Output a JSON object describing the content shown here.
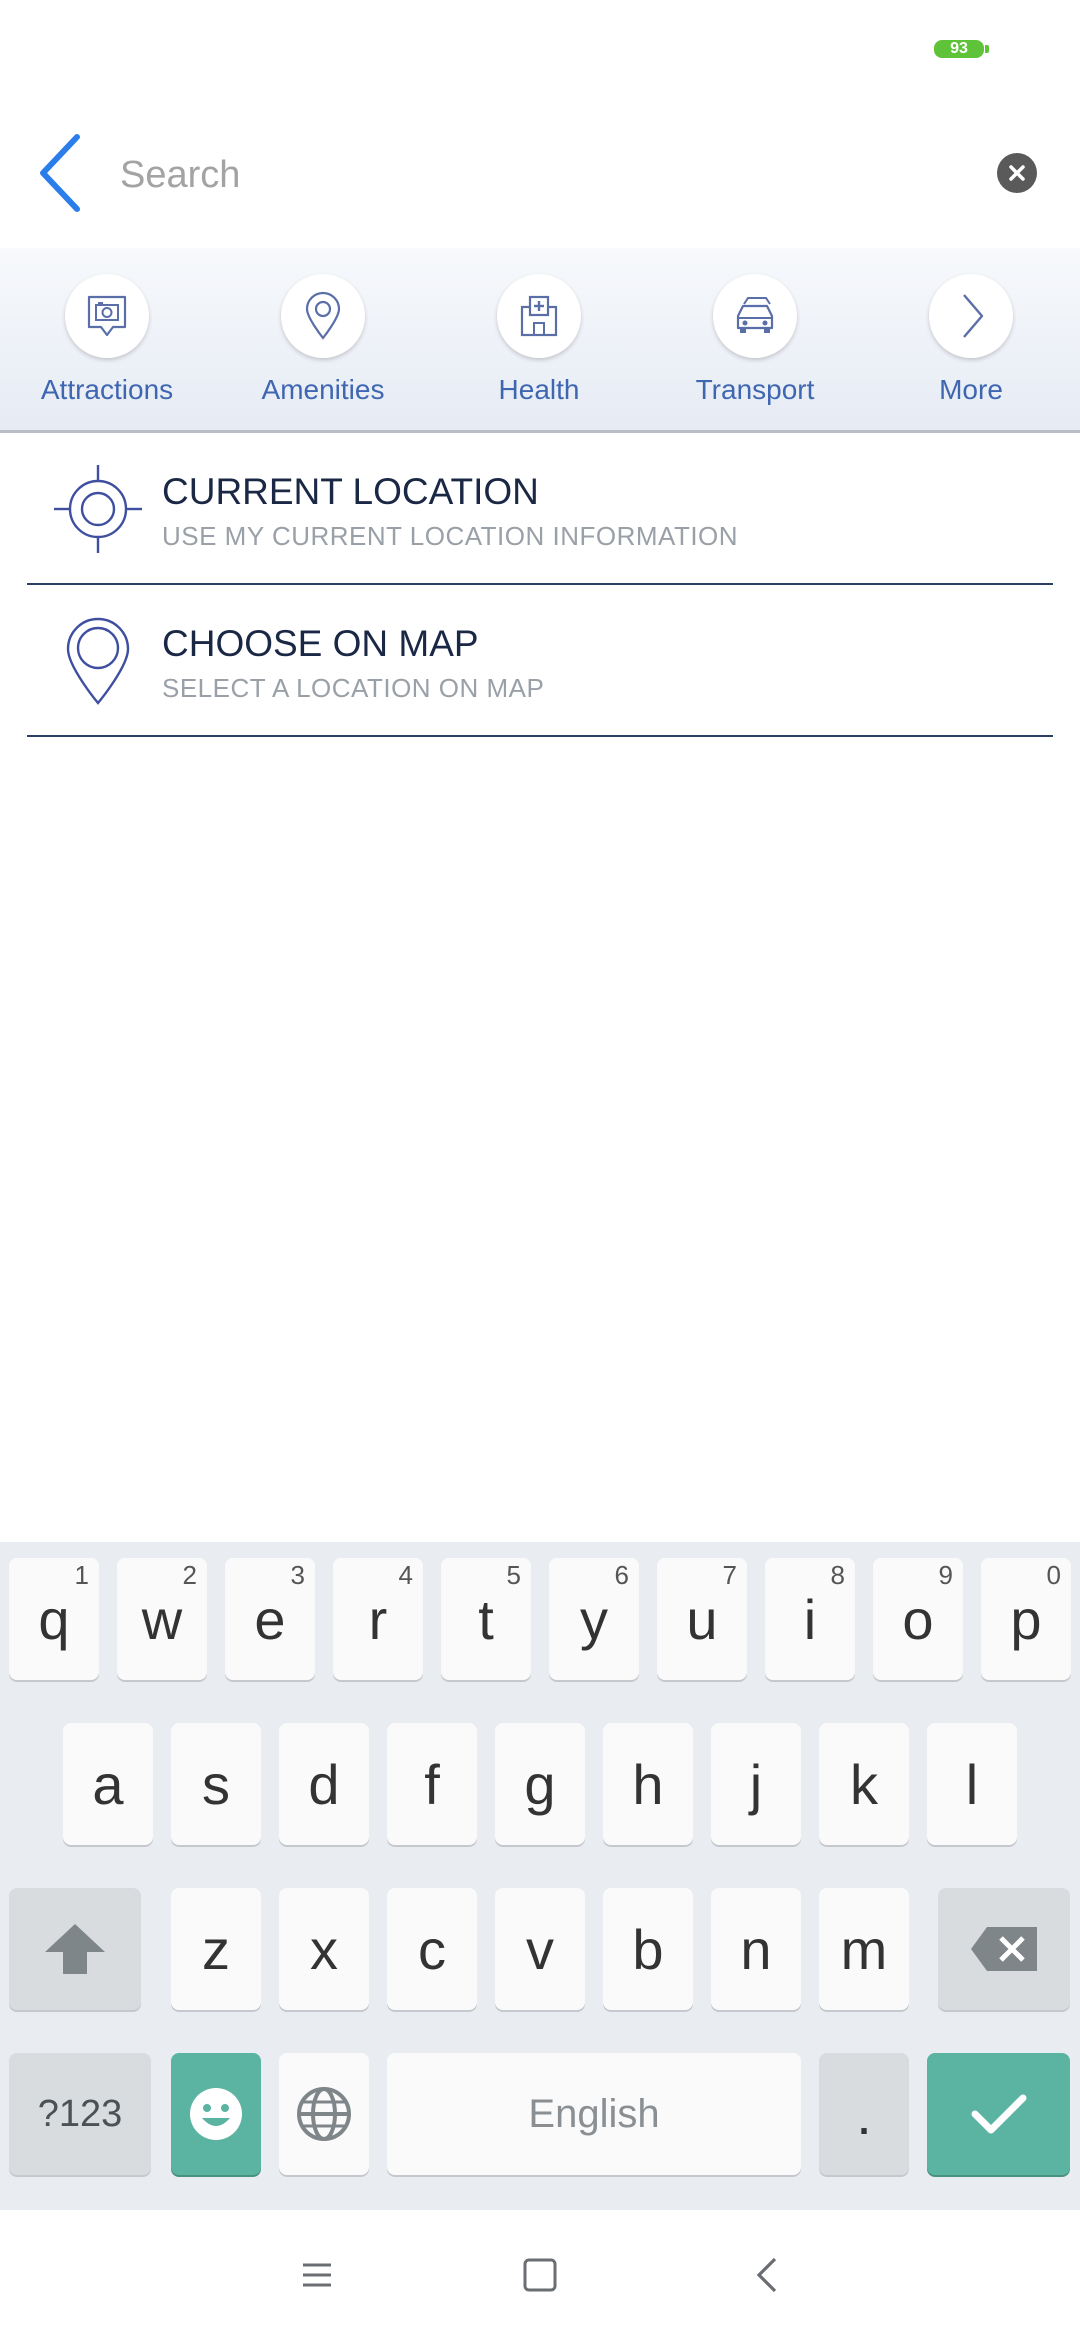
{
  "status_bar": {
    "battery": "93"
  },
  "search": {
    "placeholder": "Search",
    "value": ""
  },
  "categories": [
    {
      "label": "Attractions",
      "icon": "camera-pin-icon"
    },
    {
      "label": "Amenities",
      "icon": "map-pin-icon"
    },
    {
      "label": "Health",
      "icon": "hospital-icon"
    },
    {
      "label": "Transport",
      "icon": "car-icon"
    },
    {
      "label": "More",
      "icon": "chevron-right-icon"
    }
  ],
  "options": [
    {
      "title": "CURRENT LOCATION",
      "subtitle": "USE MY CURRENT LOCATION INFORMATION",
      "icon": "crosshair-icon"
    },
    {
      "title": "CHOOSE ON MAP",
      "subtitle": "SELECT A LOCATION ON MAP",
      "icon": "map-pin-icon"
    }
  ],
  "keyboard": {
    "row1": [
      {
        "key": "q",
        "hint": "1"
      },
      {
        "key": "w",
        "hint": "2"
      },
      {
        "key": "e",
        "hint": "3"
      },
      {
        "key": "r",
        "hint": "4"
      },
      {
        "key": "t",
        "hint": "5"
      },
      {
        "key": "y",
        "hint": "6"
      },
      {
        "key": "u",
        "hint": "7"
      },
      {
        "key": "i",
        "hint": "8"
      },
      {
        "key": "o",
        "hint": "9"
      },
      {
        "key": "p",
        "hint": "0"
      }
    ],
    "row2": [
      "a",
      "s",
      "d",
      "f",
      "g",
      "h",
      "j",
      "k",
      "l"
    ],
    "row3": [
      "z",
      "x",
      "c",
      "v",
      "b",
      "n",
      "m"
    ],
    "symbols_label": "?123",
    "space_label": "English",
    "period_label": ".",
    "accent_color": "#5bb3a1"
  },
  "colors": {
    "brand_blue": "#2b7de9",
    "label_blue": "#3f66b1",
    "battery_green": "#5fc33a"
  }
}
